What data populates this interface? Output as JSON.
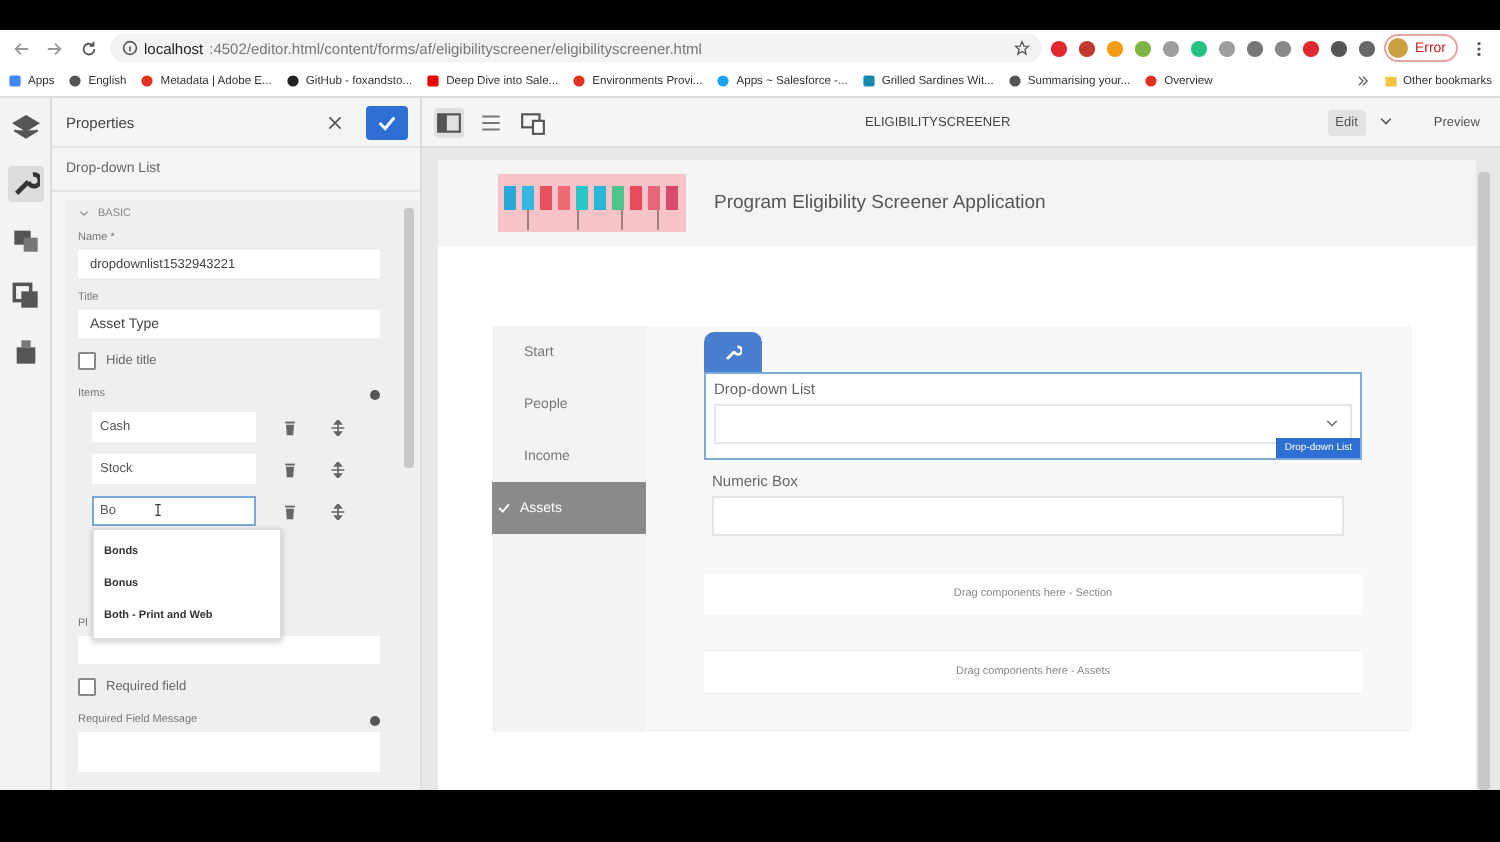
{
  "browser": {
    "url_host": "localhost",
    "url_rest": ":4502/editor.html/content/forms/af/eligibilityscreener/eligibilityscreener.html",
    "profile": "Error",
    "bookmarks": [
      {
        "label": "Apps",
        "kind": "grid"
      },
      {
        "label": "English",
        "kind": "globe"
      },
      {
        "label": "Metadata | Adobe E...",
        "kind": "adobe"
      },
      {
        "label": "GitHub - foxandsto...",
        "kind": "github"
      },
      {
        "label": "Deep Dive into Sale...",
        "kind": "video"
      },
      {
        "label": "Environments Provi...",
        "kind": "adobe"
      },
      {
        "label": "Apps ~ Salesforce -...",
        "kind": "cloud"
      },
      {
        "label": "Grilled Sardines Wit...",
        "kind": "box"
      },
      {
        "label": "Summarising your...",
        "kind": "globe"
      },
      {
        "label": "Overview",
        "kind": "adobe"
      }
    ],
    "other_bookmarks": "Other bookmarks"
  },
  "rail": {
    "items": [
      {
        "kind": "layers",
        "selected": false
      },
      {
        "kind": "wrench",
        "selected": true
      },
      {
        "kind": "assets",
        "selected": false
      },
      {
        "kind": "copy",
        "selected": false
      },
      {
        "kind": "tree",
        "selected": false
      }
    ]
  },
  "properties": {
    "title": "Properties",
    "subtitle": "Drop-down List",
    "section": "BASIC",
    "name_label": "Name *",
    "name_value": "dropdownlist1532943221",
    "title_label": "Title",
    "title_value": "Asset Type",
    "hide_title": {
      "label": "Hide title",
      "checked": false
    },
    "items_label": "Items",
    "items": [
      {
        "value": "Cash",
        "focused": false
      },
      {
        "value": "Stock",
        "focused": false
      },
      {
        "value": "Bo",
        "focused": true
      }
    ],
    "suggestions": [
      "Bonds",
      "Bonus",
      "Both - Print and Web"
    ],
    "placeholder_label": "Pl",
    "required": {
      "label": "Required field",
      "checked": false
    },
    "required_message_label": "Required Field Message"
  },
  "editor": {
    "title": "ELIGIBILITYSCREENER",
    "modes": [
      {
        "label": "Edit",
        "selected": true
      },
      {
        "label": "Preview",
        "selected": false
      }
    ],
    "form_title": "Program Eligibility Screener Application",
    "nav": [
      {
        "label": "Start",
        "selected": false
      },
      {
        "label": "People",
        "selected": false
      },
      {
        "label": "Income",
        "selected": false
      },
      {
        "label": "Assets",
        "selected": true
      }
    ],
    "dropdown": {
      "label": "Drop-down List",
      "badge": "Drop-down List",
      "selected": true
    },
    "numeric": {
      "label": "Numeric Box"
    },
    "drop_zones": [
      "Drag components here - Section",
      "Drag components here - Assets"
    ]
  }
}
